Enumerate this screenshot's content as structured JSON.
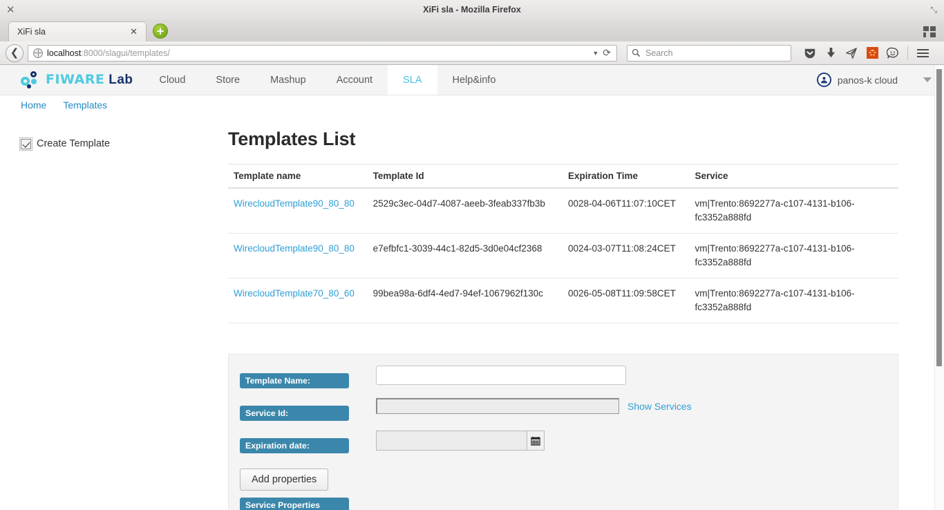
{
  "browser": {
    "window_title": "XiFi sla - Mozilla Firefox",
    "close_glyph": "✕",
    "restore_glyph": "⤡",
    "tab": {
      "label": "XiFi sla",
      "close_glyph": "✕"
    },
    "new_tab_glyph": "+",
    "back_glyph": "❮",
    "url_host": "localhost",
    "url_path": ":8000/slagui/templates/",
    "url_dropdown_glyph": "▼",
    "reload_glyph": "⟳",
    "search_placeholder": "Search",
    "toolbar_icons": [
      "pocket-icon",
      "downloads-icon",
      "send-tab-icon",
      "addon-settings-icon",
      "feedback-smiley-icon",
      "hamburger-menu-icon"
    ]
  },
  "fiware": {
    "logo": {
      "part1": "FIWARE",
      "part2": "Lab"
    },
    "menu": [
      {
        "label": "Cloud",
        "active": false
      },
      {
        "label": "Store",
        "active": false
      },
      {
        "label": "Mashup",
        "active": false
      },
      {
        "label": "Account",
        "active": false
      },
      {
        "label": "SLA",
        "active": true
      },
      {
        "label": "Help&info",
        "active": false
      }
    ],
    "user": {
      "name": "panos-k cloud",
      "avatar_glyph": "ʘ",
      "caret_glyph": "▼"
    },
    "subnav": [
      {
        "label": "Home"
      },
      {
        "label": "Templates"
      }
    ]
  },
  "sidebar": {
    "create_template_label": "Create Template",
    "create_template_checked": true
  },
  "main": {
    "title": "Templates List",
    "table": {
      "columns": [
        "Template name",
        "Template Id",
        "Expiration Time",
        "Service"
      ],
      "rows": [
        {
          "name": "WirecloudTemplate90_80_80",
          "id": "2529c3ec-04d7-4087-aeeb-3feab337fb3b",
          "expiration": "0028-04-06T11:07:10CET",
          "service": "vm|Trento:8692277a-c107-4131-b106-fc3352a888fd"
        },
        {
          "name": "WirecloudTemplate90_80_80",
          "id": "e7efbfc1-3039-44c1-82d5-3d0e04cf2368",
          "expiration": "0024-03-07T11:08:24CET",
          "service": "vm|Trento:8692277a-c107-4131-b106-fc3352a888fd"
        },
        {
          "name": "WirecloudTemplate70_80_60",
          "id": "99bea98a-6df4-4ed7-94ef-1067962f130c",
          "expiration": "0026-05-08T11:09:58CET",
          "service": "vm|Trento:8692277a-c107-4131-b106-fc3352a888fd"
        }
      ]
    },
    "form": {
      "template_name_label": "Template Name:",
      "template_name_value": "",
      "template_name_placeholder": "",
      "service_id_label": "Service Id:",
      "service_id_value": "",
      "show_services_label": "Show Services",
      "expiration_date_label": "Expiration date:",
      "expiration_date_value": "",
      "calendar_icon": "calendar-icon",
      "add_properties_label": "Add properties",
      "service_properties_label": "Service Properties"
    }
  },
  "colors": {
    "accent_blue": "#2e9fd4",
    "badge_blue": "#3b87ab",
    "logo_cyan": "#4dcbe0",
    "logo_navy": "#15306b",
    "nav_active_text": "#49c2dd"
  }
}
